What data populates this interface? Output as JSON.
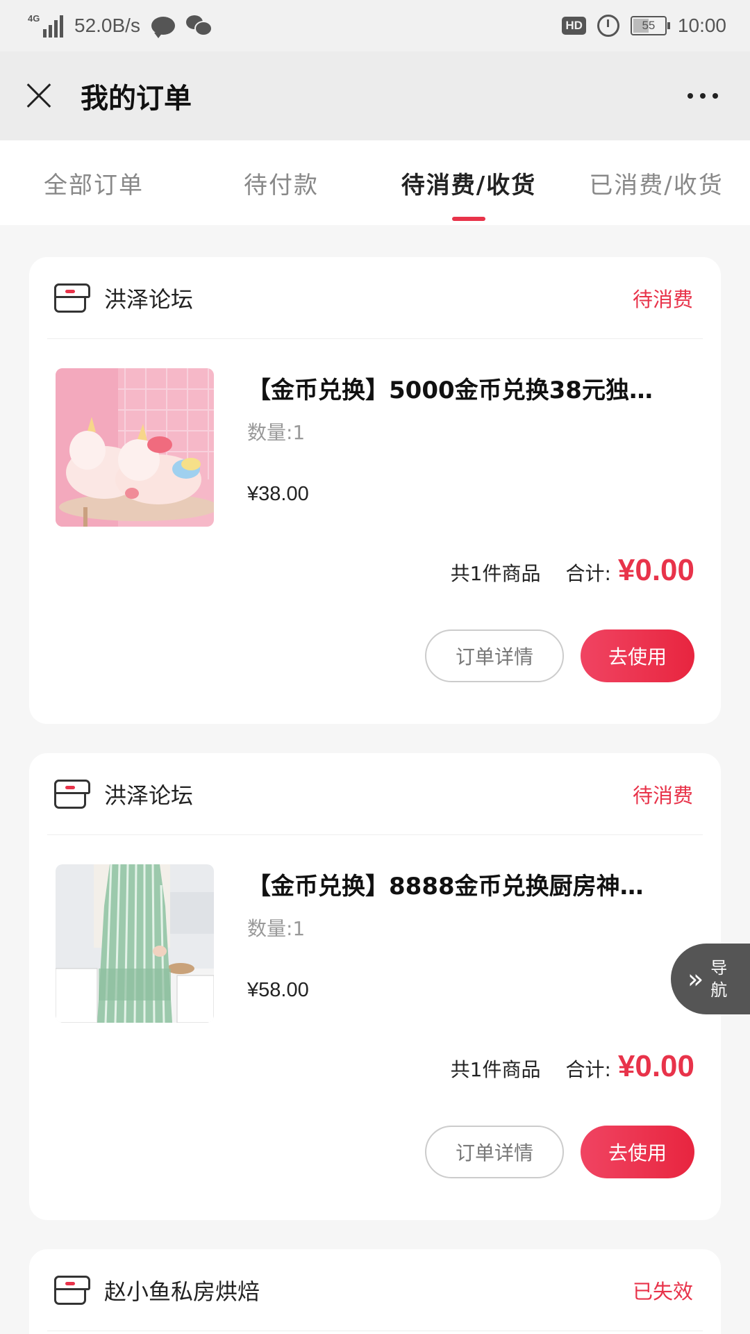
{
  "status_bar": {
    "network": "4G",
    "speed": "52.0B/s",
    "hd": "HD",
    "battery": "55",
    "time": "10:00"
  },
  "header": {
    "title": "我的订单"
  },
  "tabs": [
    {
      "label": "全部订单",
      "active": false
    },
    {
      "label": "待付款",
      "active": false
    },
    {
      "label": "待消费/收货",
      "active": true
    },
    {
      "label": "已消费/收货",
      "active": false
    }
  ],
  "orders": [
    {
      "shop": "洪泽论坛",
      "status": "待消费",
      "item_name": "【金币兑换】5000金币兑换38元独…",
      "quantity": "数量:1",
      "price": "¥38.00",
      "count_text": "共1件商品",
      "total_label": "合计:",
      "total": "¥0.00",
      "detail_button": "订单详情",
      "use_button": "去使用"
    },
    {
      "shop": "洪泽论坛",
      "status": "待消费",
      "item_name": "【金币兑换】8888金币兑换厨房神…",
      "quantity": "数量:1",
      "price": "¥58.00",
      "count_text": "共1件商品",
      "total_label": "合计:",
      "total": "¥0.00",
      "detail_button": "订单详情",
      "use_button": "去使用"
    },
    {
      "shop": "赵小鱼私房烘焙",
      "status": "已失效"
    }
  ],
  "float_nav": {
    "label": "导航"
  },
  "colors": {
    "accent": "#e8334a",
    "header_bg": "#ececec",
    "page_bg": "#f6f6f6"
  }
}
